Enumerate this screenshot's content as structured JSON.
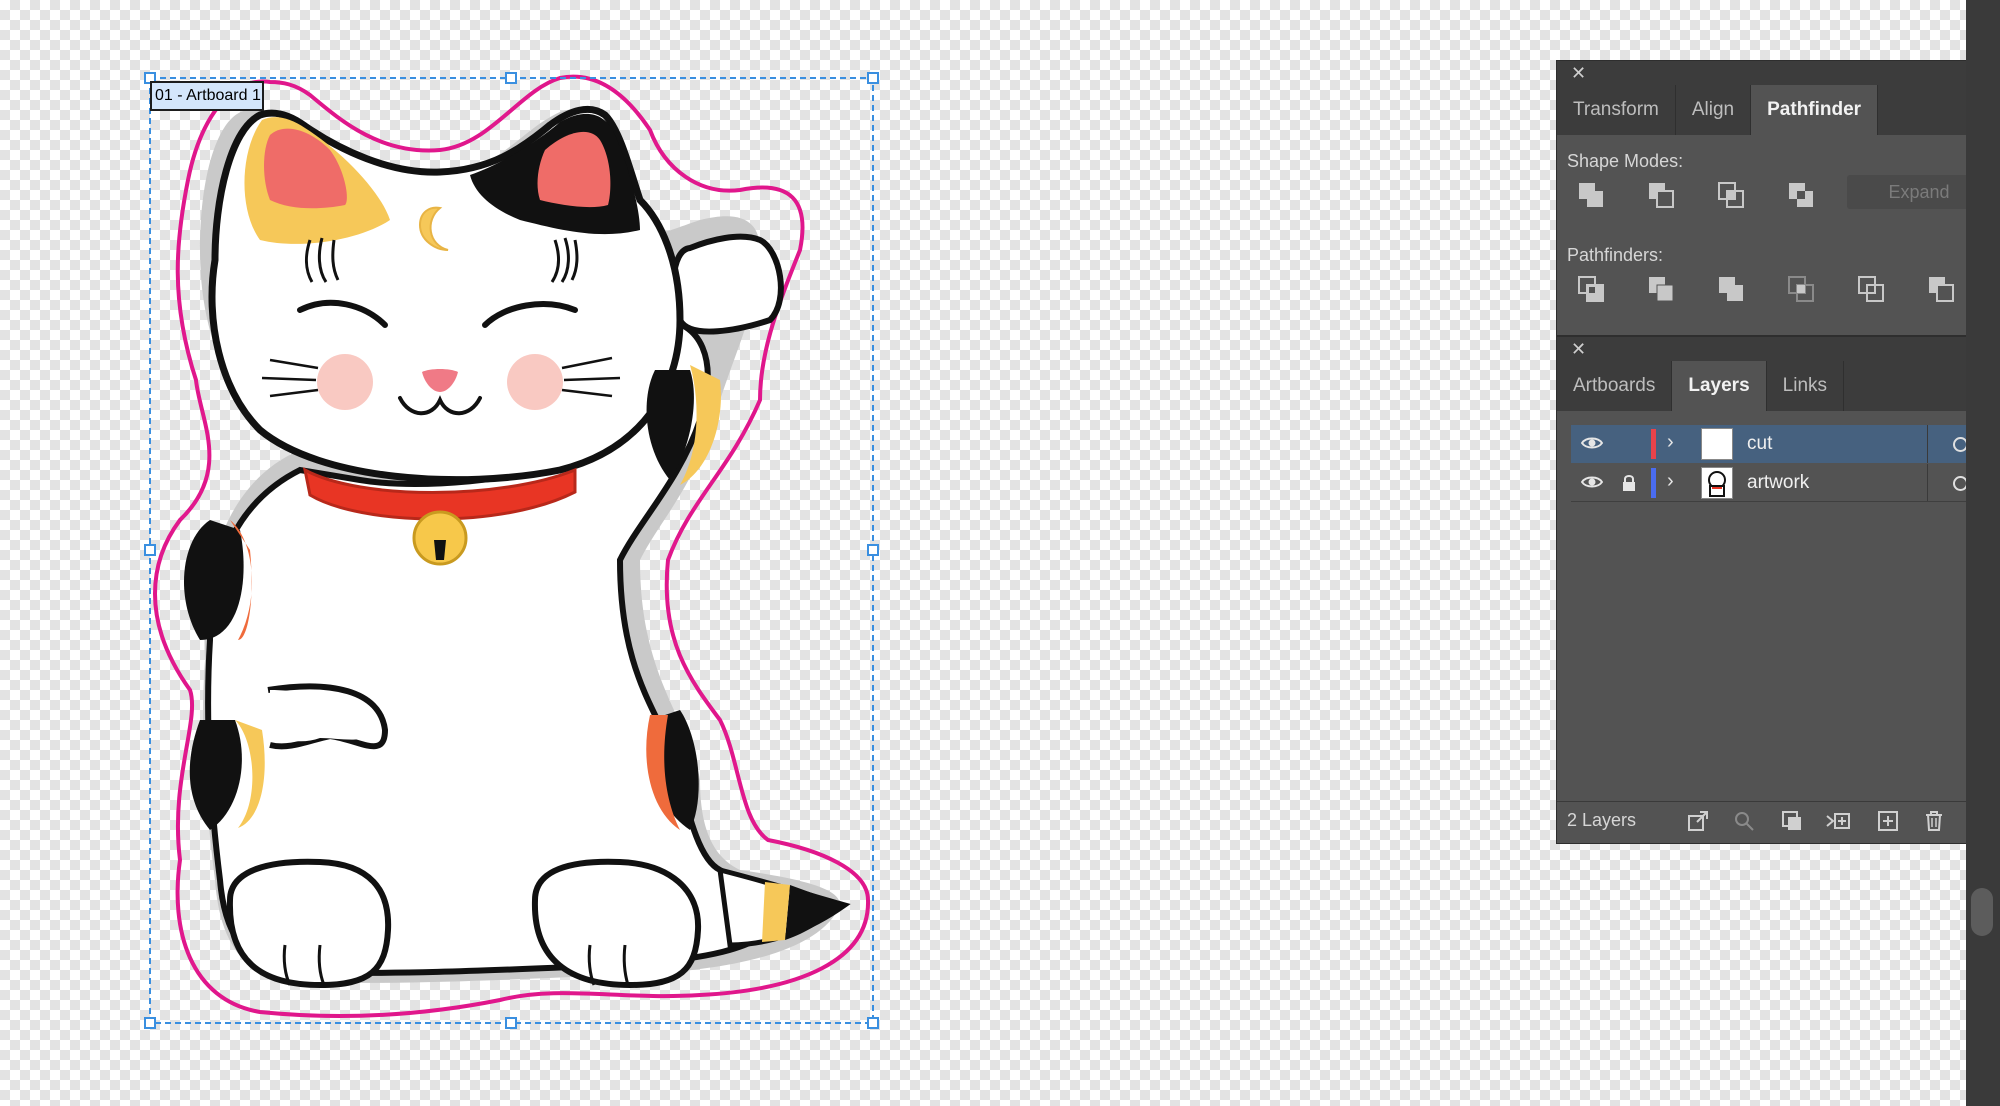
{
  "artboard": {
    "label": "01 - Artboard 1"
  },
  "pathfinder_panel": {
    "tabs": [
      {
        "label": "Transform",
        "active": false
      },
      {
        "label": "Align",
        "active": false
      },
      {
        "label": "Pathfinder",
        "active": true
      }
    ],
    "shape_modes_label": "Shape Modes:",
    "shape_mode_icons": [
      "unite-icon",
      "minus-front-icon",
      "intersect-icon",
      "exclude-icon"
    ],
    "expand_label": "Expand",
    "pathfinders_label": "Pathfinders:",
    "pathfinder_icons": [
      "divide-icon",
      "trim-icon",
      "merge-icon",
      "crop-icon",
      "outline-icon",
      "minus-back-icon"
    ]
  },
  "layers_panel": {
    "tabs": [
      {
        "label": "Artboards",
        "active": false
      },
      {
        "label": "Layers",
        "active": true
      },
      {
        "label": "Links",
        "active": false
      }
    ],
    "layers": [
      {
        "name": "cut",
        "color": "#e8434a",
        "visible": true,
        "locked": false,
        "selected": true
      },
      {
        "name": "artwork",
        "color": "#4a6cf0",
        "visible": true,
        "locked": true,
        "selected": false
      }
    ],
    "count_label": "2 Layers",
    "footer_icons": [
      "export-icon",
      "locate-object-icon",
      "clipping-mask-icon",
      "new-sublayer-icon",
      "new-layer-icon",
      "trash-icon"
    ]
  },
  "colors": {
    "cut_line": "#e0178c",
    "artboard_border": "#3a8fe0",
    "panel_bg": "#535353",
    "selection_bg": "#46617f"
  }
}
